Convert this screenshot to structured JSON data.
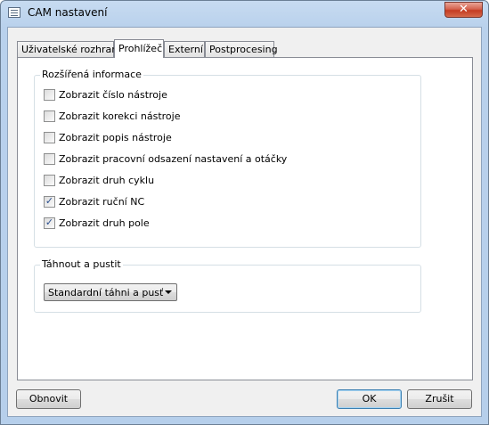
{
  "window": {
    "title": "CAM nastavení",
    "close_label": "✕"
  },
  "tabs": [
    {
      "label": "Uživatelské rozhraní",
      "active": false
    },
    {
      "label": "Prohlížeč",
      "active": true
    },
    {
      "label": "Externí",
      "active": false
    },
    {
      "label": "Postprocesing",
      "active": false
    }
  ],
  "extended_info": {
    "title": "Rozšířená informace",
    "options": [
      {
        "label": "Zobrazit číslo nástroje",
        "checked": false
      },
      {
        "label": "Zobrazit korekci nástroje",
        "checked": false
      },
      {
        "label": "Zobrazit popis nástroje",
        "checked": false
      },
      {
        "label": "Zobrazit pracovní odsazení nastavení a otáčky",
        "checked": false
      },
      {
        "label": "Zobrazit druh cyklu",
        "checked": false
      },
      {
        "label": "Zobrazit ruční NC",
        "checked": true
      },
      {
        "label": "Zobrazit druh pole",
        "checked": true
      }
    ]
  },
  "drag_drop": {
    "title": "Táhnout a pustit",
    "selected": "Standardní táhni a pusť"
  },
  "buttons": {
    "reset": "Obnovit",
    "ok": "OK",
    "cancel": "Zrušit"
  }
}
